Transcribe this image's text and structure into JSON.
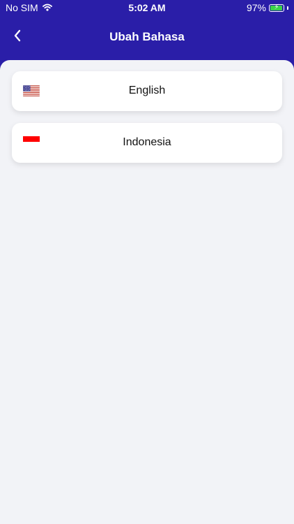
{
  "status_bar": {
    "carrier": "No SIM",
    "time": "5:02 AM",
    "battery_percent": "97%",
    "battery_level": 0.97
  },
  "nav": {
    "title": "Ubah Bahasa",
    "back_icon": "chevron-left-icon"
  },
  "languages": [
    {
      "label": "English",
      "flag_icon": "us-flag-icon"
    },
    {
      "label": "Indonesia",
      "flag_icon": "indonesia-flag-icon"
    }
  ],
  "colors": {
    "header": "#2a1ea8",
    "background": "#f2f3f7",
    "card": "#ffffff",
    "indonesia_red": "#ff0000",
    "battery_green": "#3bd24a"
  }
}
